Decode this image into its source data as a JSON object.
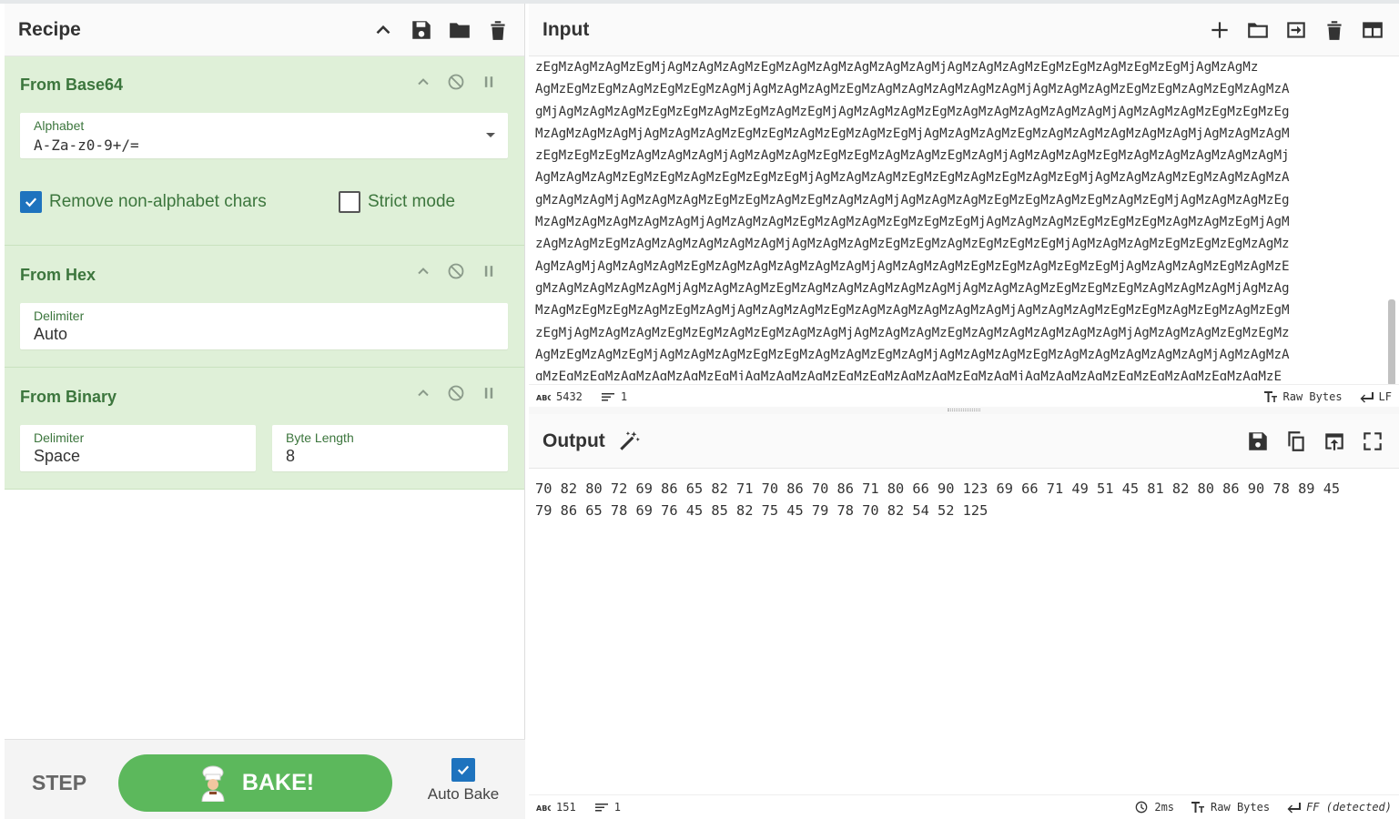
{
  "recipe": {
    "title": "Recipe",
    "icons": [
      "chevron-up-icon",
      "save-icon",
      "folder-icon",
      "trash-icon"
    ],
    "operations": [
      {
        "name": "From Base64",
        "alphabet_label": "Alphabet",
        "alphabet_value": "A-Za-z0-9+/=",
        "remove_nonalpha_label": "Remove non-alphabet chars",
        "remove_nonalpha_checked": true,
        "strict_label": "Strict mode",
        "strict_checked": false
      },
      {
        "name": "From Hex",
        "delimiter_label": "Delimiter",
        "delimiter_value": "Auto"
      },
      {
        "name": "From Binary",
        "delimiter_label": "Delimiter",
        "delimiter_value": "Space",
        "byte_length_label": "Byte Length",
        "byte_length_value": "8"
      }
    ],
    "footer": {
      "step_label": "STEP",
      "bake_label": "BAKE!",
      "auto_bake_label": "Auto Bake",
      "auto_bake_checked": true
    }
  },
  "input": {
    "title": "Input",
    "lines": [
      "zEgMzAgMzAgMzEgMjAgMzAgMzAgMzEgMzAgMzAgMzAgMzAgMzAgMjAgMzAgMzAgMzEgMzEgMzAgMzEgMzEgMjAgMzAgMz",
      "AgMzEgMzEgMzAgMzEgMzEgMzAgMjAgMzAgMzAgMzEgMzAgMzAgMzAgMzAgMzAgMjAgMzAgMzAgMzEgMzEgMzAgMzEgMzAgMzA",
      "gMjAgMzAgMzAgMzEgMzEgMzAgMzEgMzAgMzEgMjAgMzAgMzAgMzEgMzAgMzAgMzAgMzAgMzAgMjAgMzAgMzAgMzEgMzEgMzEg",
      "MzAgMzAgMzAgMjAgMzAgMzAgMzEgMzEgMzAgMzEgMzAgMzEgMjAgMzAgMzAgMzEgMzAgMzAgMzAgMzAgMzAgMjAgMzAgMzAgM",
      "zEgMzEgMzEgMzAgMzAgMzAgMjAgMzAgMzAgMzEgMzEgMzAgMzAgMzEgMzAgMjAgMzAgMzAgMzEgMzAgMzAgMzAgMzAgMzAgMj",
      "AgMzAgMzAgMzEgMzEgMzAgMzEgMzEgMzEgMjAgMzAgMzAgMzEgMzEgMzAgMzEgMzAgMzEgMjAgMzAgMzAgMzEgMzAgMzAgMzA",
      "gMzAgMzAgMjAgMzAgMzAgMzEgMzEgMzAgMzEgMzAgMzAgMjAgMzAgMzAgMzEgMzEgMzAgMzEgMzAgMzEgMjAgMzAgMzAgMzEg",
      "MzAgMzAgMzAgMzAgMzAgMjAgMzAgMzAgMzEgMzAgMzAgMzEgMzEgMzEgMjAgMzAgMzAgMzEgMzEgMzEgMzAgMzAgMzEgMjAgM",
      "zAgMzAgMzEgMzAgMzAgMzAgMzAgMzAgMjAgMzAgMzAgMzEgMzEgMzAgMzEgMzEgMzEgMjAgMzAgMzAgMzEgMzEgMzEgMzAgMz",
      "AgMzAgMjAgMzAgMzAgMzEgMzAgMzAgMzAgMzAgMzAgMjAgMzAgMzAgMzEgMzEgMzAgMzEgMzEgMjAgMzAgMzAgMzEgMzAgMzE",
      "gMzAgMzAgMzAgMzAgMjAgMzAgMzAgMzEgMzAgMzAgMzAgMzAgMzAgMjAgMzAgMzAgMzEgMzEgMzEgMzAgMzAgMzAgMjAgMzAg",
      "MzAgMzEgMzEgMzAgMzEgMzAgMjAgMzAgMzAgMzEgMzAgMzAgMzAgMzAgMzAgMjAgMzAgMzAgMzEgMzEgMzAgMzEgMzAgMzEgM",
      "zEgMjAgMzAgMzAgMzEgMzEgMzAgMzEgMzAgMzAgMjAgMzAgMzAgMzEgMzAgMzAgMzAgMzAgMzAgMjAgMzAgMzAgMzEgMzEgMz",
      "AgMzEgMzAgMzEgMjAgMzAgMzAgMzEgMzEgMzAgMzAgMzEgMzAgMjAgMzAgMzAgMzEgMzAgMzAgMzAgMzAgMzAgMjAgMzAgMzA",
      "gMzEgMzEgMzAgMzAgMzAgMzEgMjAgMzAgMzAgMzEgMzEgMzAgMzAgMzEgMzAgMjAgMzAgMzAgMzEgMzEgMzAgMzEgMzAgMzE"
    ],
    "status": {
      "length": "5432",
      "lines": "1",
      "encoding": "Raw Bytes",
      "eol": "LF"
    }
  },
  "output": {
    "title": "Output",
    "lines": [
      "70 82 80 72 69 86 65 82 71 70 86 70 86 71 80 66 90 123 69 66 71 49 51 45 81 82 80 86 90 78 89 45",
      "79 86 65 78 69 76 45 85 82 75 45 79 78 70 82 54 52 125"
    ],
    "status": {
      "length": "151",
      "lines": "1",
      "time": "2ms",
      "encoding": "Raw Bytes",
      "eol": "FF (detected)"
    }
  },
  "colors": {
    "op_bg": "#dff0d8",
    "op_text": "#3c763d",
    "bake": "#5cb85c",
    "checkbox": "#1e73be"
  }
}
